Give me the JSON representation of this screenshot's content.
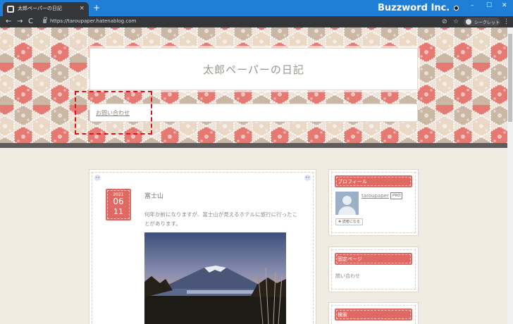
{
  "browser": {
    "tab_title": "太郎ペーパーの日記",
    "tab_close": "×",
    "new_tab": "+",
    "brand": "Buzzword Inc.",
    "window_controls": {
      "minimize": "–",
      "maximize": "☐",
      "close": "✕"
    },
    "nav": {
      "back": "←",
      "forward": "→",
      "reload": "C"
    },
    "url": "https://taroupaper.hatenablog.com",
    "eye_icon": "⊘",
    "star_icon": "☆",
    "incognito_label": "シークレット",
    "menu_icon": "⋮"
  },
  "blog": {
    "title": "太郎ペーパーの日記",
    "nav_link": "お問い合わせ"
  },
  "entry": {
    "corner_left": "••",
    "corner_right": "••",
    "date": {
      "year": "2021",
      "month": "06",
      "day": "11"
    },
    "title": "富士山",
    "text": "何年か前になりますが、富士山が見えるホテルに旅行に行ったことがあります。"
  },
  "sidebar": {
    "profile": {
      "heading": "プロフィール",
      "username": "taroupaper",
      "badge": "PRO",
      "follow_button": "✚ 読者になる"
    },
    "pages": {
      "heading": "固定ページ",
      "link": "問い合わせ"
    },
    "search": {
      "heading": "検索"
    }
  },
  "colors": {
    "titlebar": "#1f7fd6",
    "accent": "#e06a63",
    "highlight": "#e0141e"
  }
}
